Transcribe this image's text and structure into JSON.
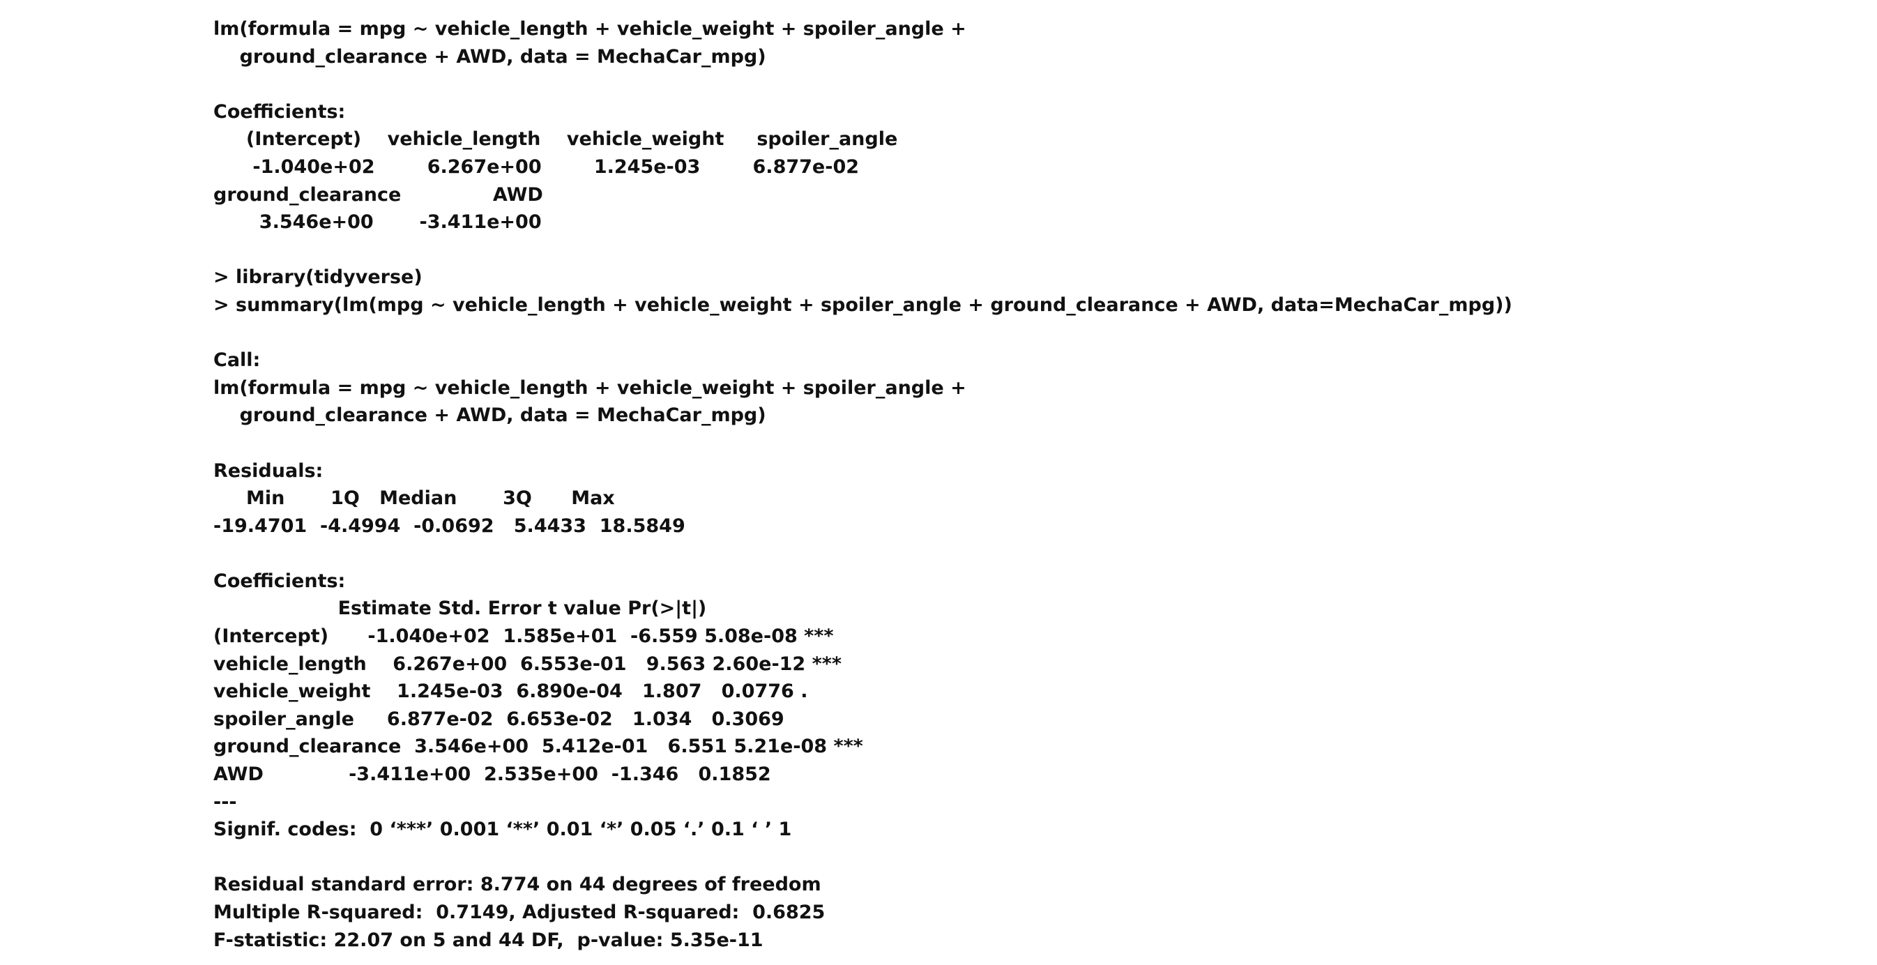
{
  "console": {
    "lines": [
      "lm(formula = mpg ~ vehicle_length + vehicle_weight + spoiler_angle +",
      "    ground_clearance + AWD, data = MechaCar_mpg)",
      "",
      "Coefficients:",
      "     (Intercept)    vehicle_length    vehicle_weight     spoiler_angle",
      "      -1.040e+02        6.267e+00        1.245e-03        6.877e-02",
      "ground_clearance              AWD",
      "       3.546e+00       -3.411e+00",
      "",
      "> library(tidyverse)",
      "> summary(lm(mpg ~ vehicle_length + vehicle_weight + spoiler_angle + ground_clearance + AWD, data=MechaCar_mpg))",
      "",
      "Call:",
      "lm(formula = mpg ~ vehicle_length + vehicle_weight + spoiler_angle +",
      "    ground_clearance + AWD, data = MechaCar_mpg)",
      "",
      "Residuals:",
      "     Min       1Q   Median       3Q      Max",
      "-19.4701  -4.4994  -0.0692   5.4433  18.5849",
      "",
      "Coefficients:",
      "                   Estimate Std. Error t value Pr(>|t|)",
      "(Intercept)      -1.040e+02  1.585e+01  -6.559 5.08e-08 ***",
      "vehicle_length    6.267e+00  6.553e-01   9.563 2.60e-12 ***",
      "vehicle_weight    1.245e-03  6.890e-04   1.807   0.0776 .",
      "spoiler_angle     6.877e-02  6.653e-02   1.034   0.3069",
      "ground_clearance  3.546e+00  5.412e-01   6.551 5.21e-08 ***",
      "AWD             -3.411e+00  2.535e+00  -1.346   0.1852",
      "---",
      "Signif. codes:  0 ‘***’ 0.001 ‘**’ 0.01 ‘*’ 0.05 ‘.’ 0.1 ‘ ’ 1",
      "",
      "Residual standard error: 8.774 on 44 degrees of freedom",
      "Multiple R-squared:  0.7149, Adjusted R-squared:  0.6825",
      "F-statistic: 22.07 on 5 and 44 DF,  p-value: 5.35e-11"
    ]
  }
}
